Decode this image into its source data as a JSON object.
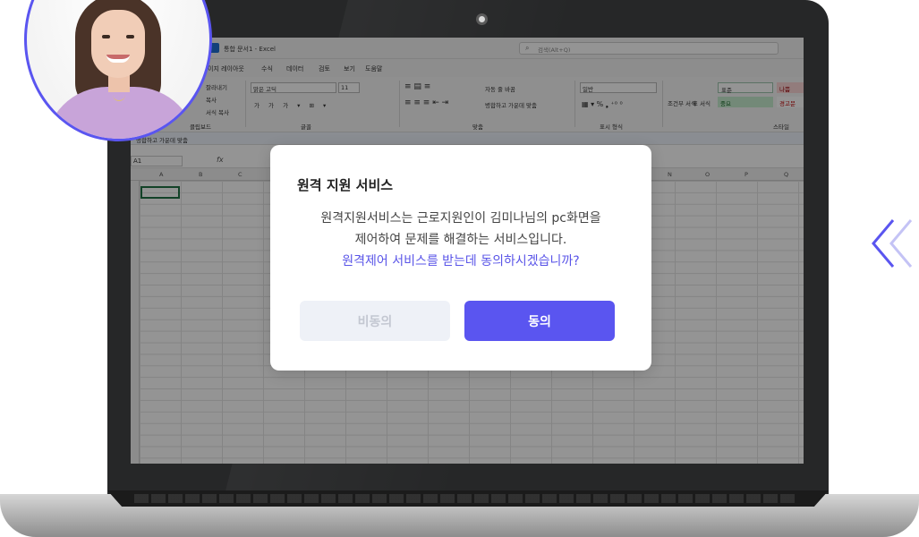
{
  "excel": {
    "doc_title": "통합 문서1 - Excel",
    "search_placeholder": "검색(Alt+Q)",
    "menu": [
      "이지 레이아웃",
      "수식",
      "데이터",
      "검토",
      "보기",
      "도움말"
    ],
    "ribbon": {
      "cut": "잘라내기",
      "copy": "복사",
      "format_painter": "서식 복사",
      "clipboard_group": "클립보드",
      "font_name": "맑은 고딕",
      "font_size": "11",
      "font_group": "글꼴",
      "wrap_text": "자동 줄 바꿈",
      "merge_center": "병합하고 가운데 맞춤",
      "align_group": "맞춤",
      "number_format": "일반",
      "number_group": "표시 형식",
      "conditional_format": "조건부 서식",
      "table_format": "표 서식",
      "style_normal": "표준",
      "style_bad": "나쁨",
      "style_neutral": "중요",
      "style_warning": "경고문",
      "style_group": "스타일"
    },
    "format_bar_label": "병합하고 가운데 맞춤",
    "name_box": "A1",
    "fx": "fx",
    "columns_left": [
      "A",
      "B",
      "C"
    ],
    "columns_right": [
      "N",
      "O",
      "P",
      "Q"
    ]
  },
  "dialog": {
    "title": "원격 지원 서비스",
    "body_line1": "원격지원서비스는 근로지원인이 김미나님의 pc화면을",
    "body_line2": "제어하여 문제를 해결하는 서비스입니다.",
    "body_question": "원격제어 서비스를 받는데 동의하시겠습니까?",
    "decline_label": "비동의",
    "agree_label": "동의"
  },
  "colors": {
    "accent": "#5a55f0",
    "highlight_text": "#5a55e8",
    "excel_green": "#217346",
    "bezel": "#262728"
  }
}
